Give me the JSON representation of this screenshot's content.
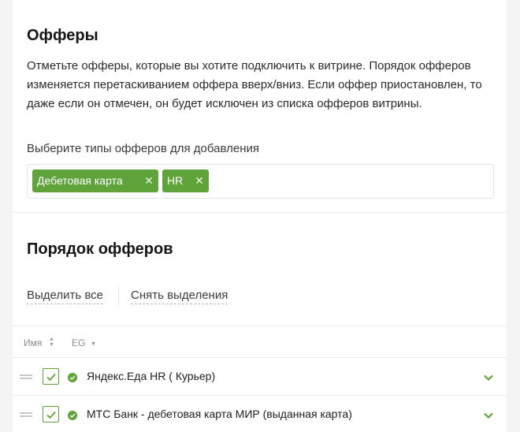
{
  "offers_section": {
    "title": "Офферы",
    "description": "Отметьте офферы, которые вы хотите подключить к витрине. Порядок офферов изменяется перетаскиванием оффера вверх/вниз. Если оффер приостановлен, то даже если он отмечен, он будет исключен из списка офферов витрины.",
    "types_label": "Выберите типы офферов для добавления",
    "selected_types": [
      {
        "label": "Дебетовая карта",
        "remove_icon": "close-icon"
      },
      {
        "label": "HR",
        "remove_icon": "close-icon"
      }
    ]
  },
  "order_section": {
    "title": "Порядок офферов",
    "select_all_label": "Выделить все",
    "clear_selection_label": "Снять выделения",
    "columns": [
      {
        "label": "Имя",
        "sort": "both"
      },
      {
        "label": "EG",
        "sort": "desc"
      }
    ],
    "rows": [
      {
        "title": "Яндекс.Еда HR ( Курьер)",
        "checked": true,
        "status": "active"
      },
      {
        "title": "МТС Банк - дебетовая карта МИР (выданная карта)",
        "checked": true,
        "status": "active"
      }
    ]
  },
  "colors": {
    "accent": "#5ea43a",
    "tag_background": "#5ea43a",
    "divider": "#ececec"
  }
}
